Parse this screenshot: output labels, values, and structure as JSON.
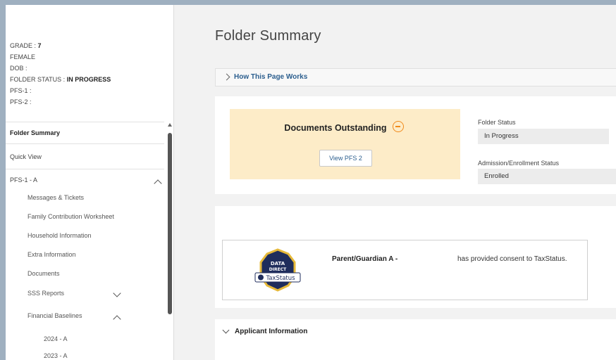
{
  "sidebar": {
    "info": {
      "grade_label": "GRADE :",
      "grade_value": "7",
      "gender": "FEMALE",
      "dob_label": "DOB :",
      "folder_status_label": "FOLDER STATUS :",
      "folder_status_value": "IN PROGRESS",
      "pfs1_label": "PFS-1 :",
      "pfs2_label": "PFS-2 :"
    },
    "nav": {
      "folder_summary": "Folder Summary",
      "quick_view": "Quick View",
      "pfs1a": "PFS-1 - A",
      "messages": "Messages & Tickets",
      "fcw": "Family Contribution Worksheet",
      "household": "Household Information",
      "extra": "Extra Information",
      "documents": "Documents",
      "sss_reports": "SSS Reports",
      "financial_baselines": "Financial Baselines",
      "y2024": "2024 - A",
      "y2023": "2023 - A"
    }
  },
  "main": {
    "title": "Folder Summary",
    "how_this_page_works": "How This Page Works",
    "documents_outstanding": "Documents Outstanding",
    "view_pfs2_button": "View PFS 2",
    "folder_status_label": "Folder Status",
    "folder_status_value": "In Progress",
    "admission_label": "Admission/Enrollment Status",
    "admission_value": "Enrolled",
    "consent": {
      "badge_line1": "DATA",
      "badge_line2": "DIRECT",
      "badge_brand": "TaxStatus",
      "name": "Parent/Guardian A -",
      "text": "has provided consent to TaxStatus."
    },
    "applicant_information": "Applicant Information"
  },
  "colors": {
    "link_blue": "#2b5e8e",
    "warning_orange": "#f08a1c",
    "docs_bg": "#fdecc8",
    "badge_navy": "#1f2d5c",
    "badge_gold": "#e6b93a"
  },
  "icons": {
    "outstanding": "minus-circle-icon",
    "expand": "chevron-right-icon",
    "collapse": "chevron-up-icon",
    "expand_down": "chevron-down-icon"
  }
}
